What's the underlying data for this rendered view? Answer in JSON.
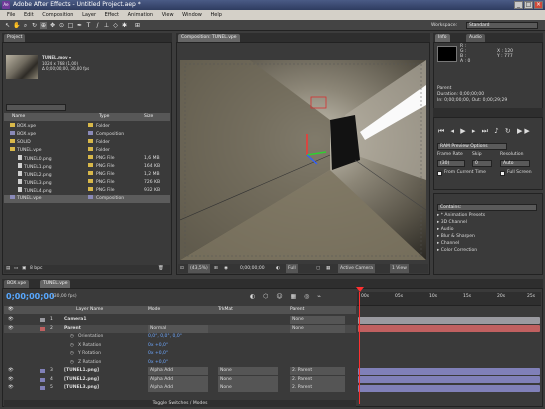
{
  "titlebar": {
    "app_icon": "Ae",
    "title": "Adobe After Effects - Untitled Project.aep *"
  },
  "menubar": {
    "items": [
      "File",
      "Edit",
      "Composition",
      "Layer",
      "Effect",
      "Animation",
      "View",
      "Window",
      "Help"
    ]
  },
  "toolbar": {
    "workspace_label": "Workspace:",
    "workspace_value": "Standard"
  },
  "project": {
    "tab": "Project",
    "selected_name": "TUNEL.mov ▾",
    "info_lines": [
      "1024 x 768 (1,00)",
      "Δ 0;00;00;00, 30,00 fps"
    ],
    "columns": {
      "name": "Name",
      "type": "Type",
      "size": "Size"
    },
    "items": [
      {
        "name": "BOX.vpe",
        "type": "Folder",
        "size": "",
        "kind": "folder",
        "color": "#d8b84a"
      },
      {
        "name": "BOX.vpe",
        "type": "Composition",
        "size": "",
        "kind": "comp",
        "color": "#8a8ab8"
      },
      {
        "name": "SOLID",
        "type": "Folder",
        "size": "",
        "kind": "folder",
        "color": "#d8b84a"
      },
      {
        "name": "TUNEL.vpe",
        "type": "Folder",
        "size": "",
        "kind": "folder",
        "color": "#d8b84a"
      },
      {
        "name": "TUNEL0.png",
        "type": "PNG File",
        "size": "1,6 MB",
        "kind": "file",
        "color": "#d8b84a"
      },
      {
        "name": "TUNEL1.png",
        "type": "PNG File",
        "size": "164 KB",
        "kind": "file",
        "color": "#d8b84a"
      },
      {
        "name": "TUNEL2.png",
        "type": "PNG File",
        "size": "1,2 MB",
        "kind": "file",
        "color": "#d8b84a"
      },
      {
        "name": "TUNEL3.png",
        "type": "PNG File",
        "size": "726 KB",
        "kind": "file",
        "color": "#d8b84a"
      },
      {
        "name": "TUNEL4.png",
        "type": "PNG File",
        "size": "932 KB",
        "kind": "file",
        "color": "#d8b84a"
      },
      {
        "name": "TUNEL.vpe",
        "type": "Composition",
        "size": "",
        "kind": "comp",
        "color": "#8a8ab8"
      }
    ],
    "footer": "8 bpc"
  },
  "composition": {
    "tab": "Composition: TUNEL.vpe",
    "footer": {
      "zoom": "(43,5%)",
      "time": "0;00;00;00",
      "resolution": "Full",
      "camera": "Active Camera",
      "views": "1 View"
    }
  },
  "info": {
    "tabs": [
      "Info",
      "Audio"
    ],
    "lines": [
      "R :",
      "G :",
      "B :",
      "A : 0"
    ],
    "coords": [
      "X : 120",
      "Y : 777"
    ],
    "detail": [
      "Parent",
      "Duration: 0;00;00;00",
      "In: 0;00;00;00, Out: 0;00;29;29"
    ]
  },
  "time_controls": {
    "tab": "Time Controls",
    "preview": "RAM Preview Options",
    "frame_rate_label": "Frame Rate",
    "frame_rate": "(30)",
    "skip_label": "Skip",
    "skip": "0",
    "resolution_label": "Resolution",
    "resolution": "Auto",
    "from_current": "From Current Time",
    "full_screen": "Full Screen"
  },
  "effects": {
    "tab": "Effects & Presets",
    "search": "Contains:",
    "items": [
      "* Animation Presets",
      "3D Channel",
      "Audio",
      "Blur & Sharpen",
      "Channel",
      "Color Correction"
    ]
  },
  "timeline": {
    "tabs": [
      "BOX.vpe",
      "TUNEL.vpe"
    ],
    "timecode": "0;00;00;00",
    "fps": "(30,00 fps)",
    "columns": {
      "layer": "Layer Name",
      "mode": "Mode",
      "trkmat": "TrkMat",
      "parent": "Parent"
    },
    "ruler": [
      "00s",
      "05s",
      "10s",
      "15s",
      "20s",
      "25s"
    ],
    "layers": [
      {
        "num": "1",
        "name": "Camera1",
        "mode": "",
        "trkmat": "",
        "parent": "None",
        "color": "#9a9aa0"
      },
      {
        "num": "2",
        "name": "Parent",
        "mode": "Normal",
        "trkmat": "",
        "parent": "None",
        "color": "#c06060"
      }
    ],
    "properties": [
      {
        "name": "Orientation",
        "value": "0,0°, 0,0°, 0,0°"
      },
      {
        "name": "X Rotation",
        "value": "0x +0,0°"
      },
      {
        "name": "Y Rotation",
        "value": "0x +0,0°"
      },
      {
        "name": "Z Rotation",
        "value": "0x +0,0°"
      }
    ],
    "image_layers": [
      {
        "num": "3",
        "name": "[TUNEL1.png]",
        "mode": "Alpha Add",
        "trkmat": "None",
        "parent": "2. Parent",
        "color": "#8080b8"
      },
      {
        "num": "4",
        "name": "[TUNEL2.png]",
        "mode": "Alpha Add",
        "trkmat": "None",
        "parent": "2. Parent",
        "color": "#8080b8"
      },
      {
        "num": "5",
        "name": "[TUNEL3.png]",
        "mode": "Alpha Add",
        "trkmat": "None",
        "parent": "2. Parent",
        "color": "#8080b8"
      }
    ],
    "footer": "Toggle Switches / Modes"
  }
}
